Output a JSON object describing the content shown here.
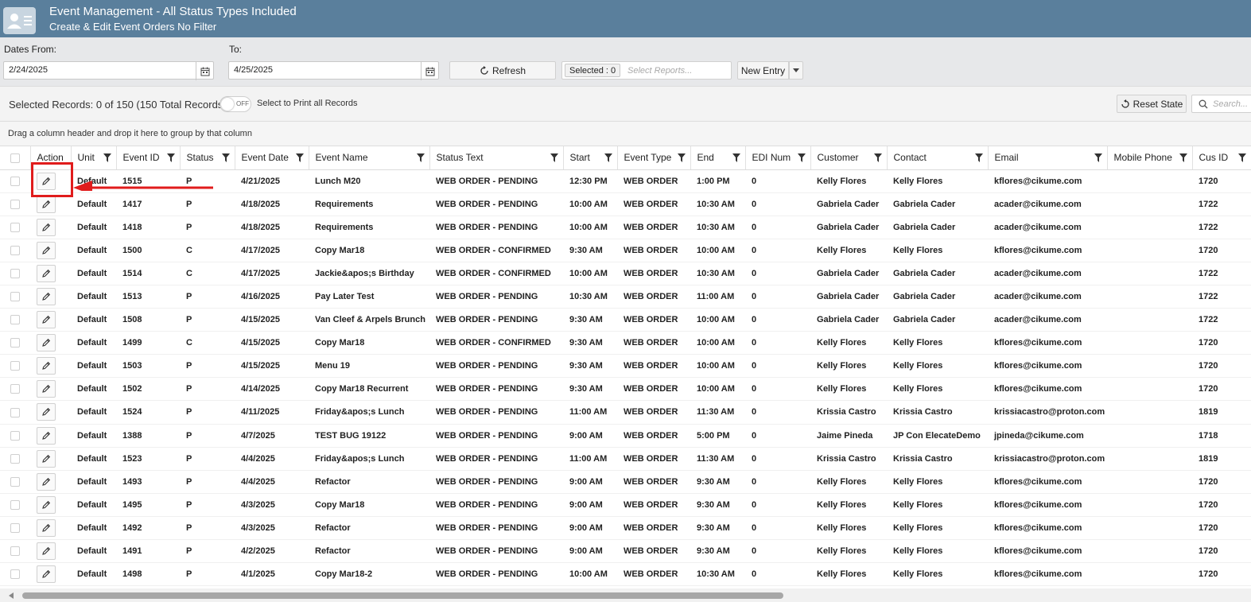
{
  "header": {
    "title": "Event Management - All Status Types Included",
    "subtitle": "Create & Edit Event Orders No Filter"
  },
  "filters": {
    "dates_from_label": "Dates From:",
    "dates_from_value": "2/24/2025",
    "to_label": "To:",
    "to_value": "4/25/2025",
    "refresh_label": "Refresh",
    "selected_chip": "Selected : 0",
    "reports_placeholder": "Select Reports...",
    "new_entry_label": "New Entry"
  },
  "toolbar": {
    "records_text": "Selected Records: 0 of 150 (150 Total Records)",
    "toggle_text": "OFF",
    "print_label": "Select to Print all Records",
    "reset_label": "Reset State",
    "search_placeholder": "Search..."
  },
  "group_hint": "Drag a column header and drop it here to group by that column",
  "columns": [
    "Action",
    "Unit",
    "Event ID",
    "Status",
    "Event Date",
    "Event Name",
    "Status Text",
    "Start",
    "Event Type",
    "End",
    "EDI Num",
    "Customer",
    "Contact",
    "Email",
    "Mobile Phone",
    "Cus ID"
  ],
  "rows": [
    [
      "Default",
      "1515",
      "P",
      "4/21/2025",
      "Lunch M20",
      "WEB ORDER - PENDING",
      "12:30 PM",
      "WEB ORDER",
      "1:00 PM",
      "0",
      "Kelly Flores",
      "Kelly Flores",
      "kflores@cikume.com",
      "",
      "1720"
    ],
    [
      "Default",
      "1417",
      "P",
      "4/18/2025",
      "Requirements",
      "WEB ORDER - PENDING",
      "10:00 AM",
      "WEB ORDER",
      "10:30 AM",
      "0",
      "Gabriela Cader",
      "Gabriela Cader",
      "acader@cikume.com",
      "",
      "1722"
    ],
    [
      "Default",
      "1418",
      "P",
      "4/18/2025",
      "Requirements",
      "WEB ORDER - PENDING",
      "10:00 AM",
      "WEB ORDER",
      "10:30 AM",
      "0",
      "Gabriela Cader",
      "Gabriela Cader",
      "acader@cikume.com",
      "",
      "1722"
    ],
    [
      "Default",
      "1500",
      "C",
      "4/17/2025",
      "Copy Mar18",
      "WEB ORDER - CONFIRMED",
      "9:30 AM",
      "WEB ORDER",
      "10:00 AM",
      "0",
      "Kelly Flores",
      "Kelly Flores",
      "kflores@cikume.com",
      "",
      "1720"
    ],
    [
      "Default",
      "1514",
      "C",
      "4/17/2025",
      "Jackie&apos;s Birthday",
      "WEB ORDER - CONFIRMED",
      "10:00 AM",
      "WEB ORDER",
      "10:30 AM",
      "0",
      "Gabriela Cader",
      "Gabriela Cader",
      "acader@cikume.com",
      "",
      "1722"
    ],
    [
      "Default",
      "1513",
      "P",
      "4/16/2025",
      "Pay Later Test",
      "WEB ORDER - PENDING",
      "10:30 AM",
      "WEB ORDER",
      "11:00 AM",
      "0",
      "Gabriela Cader",
      "Gabriela Cader",
      "acader@cikume.com",
      "",
      "1722"
    ],
    [
      "Default",
      "1508",
      "P",
      "4/15/2025",
      "Van Cleef & Arpels Brunch",
      "WEB ORDER - PENDING",
      "9:30 AM",
      "WEB ORDER",
      "10:00 AM",
      "0",
      "Gabriela Cader",
      "Gabriela Cader",
      "acader@cikume.com",
      "",
      "1722"
    ],
    [
      "Default",
      "1499",
      "C",
      "4/15/2025",
      "Copy Mar18",
      "WEB ORDER - CONFIRMED",
      "9:30 AM",
      "WEB ORDER",
      "10:00 AM",
      "0",
      "Kelly Flores",
      "Kelly Flores",
      "kflores@cikume.com",
      "",
      "1720"
    ],
    [
      "Default",
      "1503",
      "P",
      "4/15/2025",
      "Menu 19",
      "WEB ORDER - PENDING",
      "9:30 AM",
      "WEB ORDER",
      "10:00 AM",
      "0",
      "Kelly Flores",
      "Kelly Flores",
      "kflores@cikume.com",
      "",
      "1720"
    ],
    [
      "Default",
      "1502",
      "P",
      "4/14/2025",
      "Copy Mar18 Recurrent",
      "WEB ORDER - PENDING",
      "9:30 AM",
      "WEB ORDER",
      "10:00 AM",
      "0",
      "Kelly Flores",
      "Kelly Flores",
      "kflores@cikume.com",
      "",
      "1720"
    ],
    [
      "Default",
      "1524",
      "P",
      "4/11/2025",
      "Friday&apos;s Lunch",
      "WEB ORDER - PENDING",
      "11:00 AM",
      "WEB ORDER",
      "11:30 AM",
      "0",
      "Krissia Castro",
      "Krissia Castro",
      "krissiacastro@proton.com",
      "",
      "1819"
    ],
    [
      "Default",
      "1388",
      "P",
      "4/7/2025",
      "TEST BUG 19122",
      "WEB ORDER - PENDING",
      "9:00 AM",
      "WEB ORDER",
      "5:00 PM",
      "0",
      "Jaime Pineda",
      "JP Con ElecateDemo",
      "jpineda@cikume.com",
      "",
      "1718"
    ],
    [
      "Default",
      "1523",
      "P",
      "4/4/2025",
      "Friday&apos;s Lunch",
      "WEB ORDER - PENDING",
      "11:00 AM",
      "WEB ORDER",
      "11:30 AM",
      "0",
      "Krissia Castro",
      "Krissia Castro",
      "krissiacastro@proton.com",
      "",
      "1819"
    ],
    [
      "Default",
      "1493",
      "P",
      "4/4/2025",
      "Refactor",
      "WEB ORDER - PENDING",
      "9:00 AM",
      "WEB ORDER",
      "9:30 AM",
      "0",
      "Kelly Flores",
      "Kelly Flores",
      "kflores@cikume.com",
      "",
      "1720"
    ],
    [
      "Default",
      "1495",
      "P",
      "4/3/2025",
      "Copy Mar18",
      "WEB ORDER - PENDING",
      "9:00 AM",
      "WEB ORDER",
      "9:30 AM",
      "0",
      "Kelly Flores",
      "Kelly Flores",
      "kflores@cikume.com",
      "",
      "1720"
    ],
    [
      "Default",
      "1492",
      "P",
      "4/3/2025",
      "Refactor",
      "WEB ORDER - PENDING",
      "9:00 AM",
      "WEB ORDER",
      "9:30 AM",
      "0",
      "Kelly Flores",
      "Kelly Flores",
      "kflores@cikume.com",
      "",
      "1720"
    ],
    [
      "Default",
      "1491",
      "P",
      "4/2/2025",
      "Refactor",
      "WEB ORDER - PENDING",
      "9:00 AM",
      "WEB ORDER",
      "9:30 AM",
      "0",
      "Kelly Flores",
      "Kelly Flores",
      "kflores@cikume.com",
      "",
      "1720"
    ],
    [
      "Default",
      "1498",
      "P",
      "4/1/2025",
      "Copy Mar18-2",
      "WEB ORDER - PENDING",
      "10:00 AM",
      "WEB ORDER",
      "10:30 AM",
      "0",
      "Kelly Flores",
      "Kelly Flores",
      "kflores@cikume.com",
      "",
      "1720"
    ]
  ],
  "colors": {
    "header_bg": "#5a7f9c",
    "annotation_red": "#e01c1c"
  },
  "icons": [
    "user-card-icon",
    "calendar-icon",
    "refresh-icon",
    "chevron-down-icon",
    "reset-icon",
    "search-icon",
    "filter-icon",
    "pencil-icon"
  ]
}
